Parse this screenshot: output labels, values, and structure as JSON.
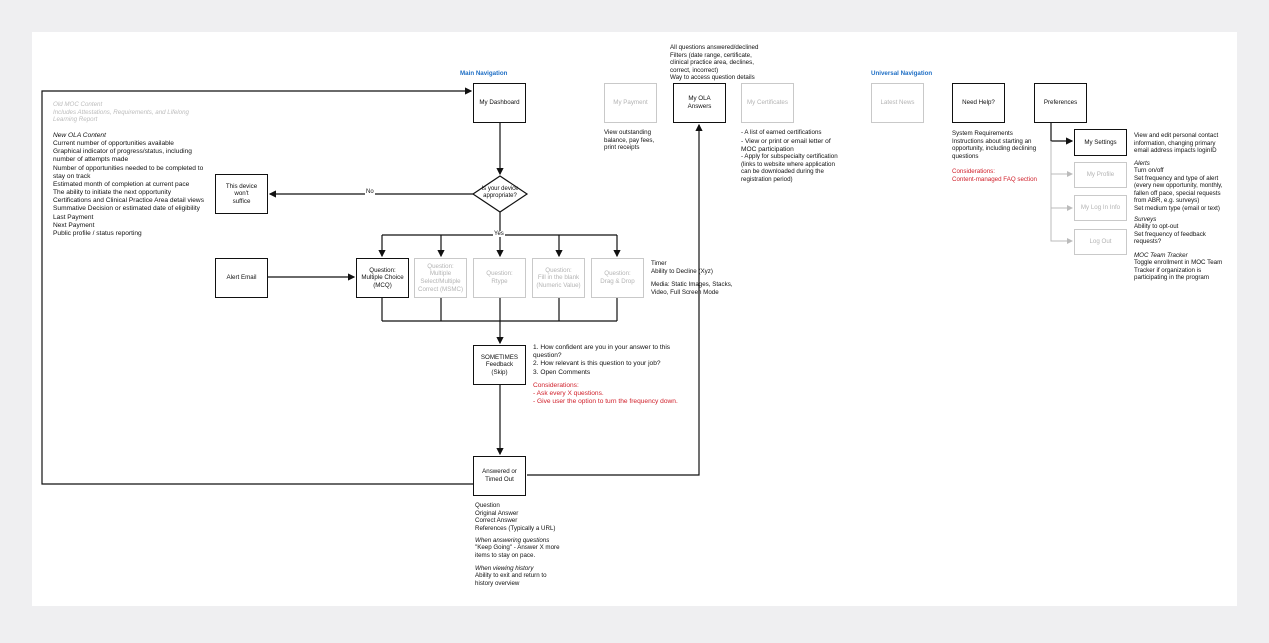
{
  "sections": {
    "main_navigation": "Main Navigation",
    "universal_navigation": "Universal Navigation"
  },
  "nav_boxes": {
    "my_dashboard": "My Dashboard",
    "my_payment": "My Payment",
    "my_ola_answers": "My OLA Answers",
    "my_certificates": "My Certificates",
    "latest_news": "Latest News",
    "need_help": "Need Help?",
    "preferences": "Preferences",
    "my_settings": "My Settings",
    "my_profile": "My Profile",
    "my_log_in_info": "My Log In Info",
    "log_out": "Log Out"
  },
  "flow": {
    "device_question": "Is your device\nappropriate?",
    "device_not_suffice": "This device won't\nsuffice",
    "no_label": "No",
    "yes_label": "Yes",
    "alert_email": "Alert Email",
    "question_mcq": "Question:\nMultiple Choice\n(MCQ)",
    "question_msmc": "Question:\nMultiple\nSelect/Multiple\nCorrect (MSMC)",
    "question_rtype": "Question:\nRtype",
    "question_fill": "Question:\nFill in the blank\n(Numeric Value)",
    "question_drag": "Question:\nDrag & Drop",
    "feedback": "SOMETIMES\nFeedback\n(Skip)",
    "answered": "Answered or\nTimed Out"
  },
  "notes": {
    "old_moc": "Old MOC Content\nIncludes Attestations, Requirements, and Lifelong\nLearning Report",
    "new_ola_title": "New OLA Content",
    "new_ola_body": "Current number of opportunities available\nGraphical indicator of progress/status, including\nnumber of attempts made\nNumber of opportunities needed to be completed to\nstay on track\nEstimated month of completion at current pace\nThe ability to initiate the next opportunity\nCertifications and Clinical Practice Area detail views\nSummative Decision or estimated date of eligibility\nLast Payment\nNext Payment\nPublic profile / status reporting",
    "answers_top": "All questions answered/declined\nFilters (date range, certificate,\nclinical practice area, declines,\ncorrect, incorrect)\nWay to access question details",
    "payment": "View outstanding\nbalance, pay fees,\nprint receipts",
    "certificates_1": "- A list of earned certifications",
    "certificates_2": "- View or print or email letter of\nMOC participation",
    "certificates_3": "- Apply for subspecialty certification\n(links to website where application\ncan be downloaded during the\nregistration period)",
    "help": "System Requirements\nInstructions about starting an\nopportunity, including declining\nquestions",
    "help_considerations": "Considerations:\nContent-managed FAQ section",
    "settings_desc": "View and edit personal contact\ninformation, changing primary\nemail address impacts loginID",
    "alerts_title": "Alerts",
    "alerts_body": "Turn on/off\nSet frequency and type of alert\n(every new opportunity, monthly,\nfallen off pace, special requests\nfrom ABR, e.g. surveys)\nSet medium type (email or text)",
    "surveys_title": "Surveys",
    "surveys_body": "Ability to opt-out\nSet frequency of feedback\nrequests?",
    "tracker_title": "MOC Team Tracker",
    "tracker_body": "Toggle enrollment in MOC Team\nTracker if organization is\nparticipating in the program",
    "timer": "Timer\nAbility to Decline (Xyz)",
    "media": "Media: Static Images, Stacks,\nVideo, Full Screen Mode",
    "feedback_questions": "1. How confident are you in your answer to this\nquestion?\n2. How relevant is this question to your job?\n3. Open Comments",
    "feedback_considerations": "Considerations:\n- Ask every X questions.\n- Give user the option to turn the frequency down.",
    "answer_details": "Question\nOriginal Answer\nCorrect Answer\nReferences (Typically a URL)",
    "answering_title": "When answering questions",
    "answering_body": "\"Keep Going\" - Answer X more\nitems to stay on pace.",
    "viewing_title": "When viewing history",
    "viewing_body": "Ability to exit and return to\nhistory overview"
  },
  "colors": {
    "background": "#efeff1",
    "canvas": "#ffffff",
    "section_heading": "#1f6fc5",
    "considerations": "#d0202b",
    "dimmed": "#b4b4b4"
  }
}
